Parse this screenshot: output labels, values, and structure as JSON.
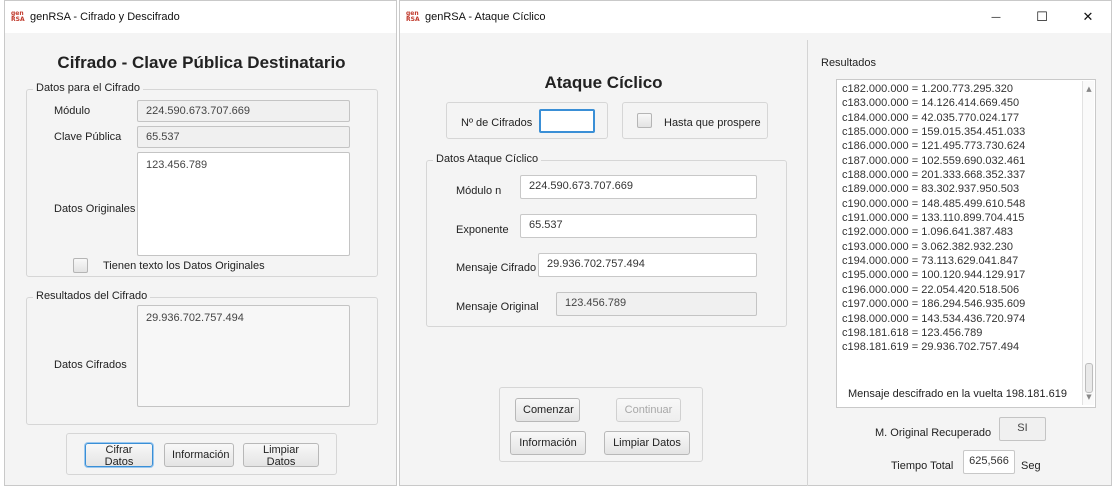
{
  "window1": {
    "logo_top": "gen",
    "logo_bottom": "RSA",
    "title": "genRSA - Cifrado y Descifrado",
    "heading": "Cifrado - Clave Pública Destinatario",
    "group_datos": {
      "legend": "Datos para el Cifrado",
      "modulo_label": "Módulo",
      "modulo_value": "224.590.673.707.669",
      "clave_label": "Clave Pública",
      "clave_value": "65.537",
      "originales_label": "Datos Originales",
      "originales_value": "123.456.789",
      "checkbox_label": "Tienen texto los Datos Originales"
    },
    "group_resultados": {
      "legend": "Resultados del Cifrado",
      "cifrados_label": "Datos Cifrados",
      "cifrados_value": "29.936.702.757.494"
    },
    "buttons": {
      "cifrar": "Cifrar Datos",
      "informacion": "Información",
      "limpiar": "Limpiar Datos"
    }
  },
  "window2": {
    "logo_top": "gen",
    "logo_bottom": "RSA",
    "title": "genRSA - Ataque Cíclico",
    "controls": {
      "minimize": "—",
      "maximize": "☐",
      "close": "✕"
    },
    "heading": "Ataque Cíclico",
    "num_cifrados_label": "Nº de Cifrados",
    "num_cifrados_value": "",
    "hasta_label": "Hasta que prospere",
    "group_ataque": {
      "legend": "Datos Ataque Cíclico",
      "modulo_label": "Módulo n",
      "modulo_value": "224.590.673.707.669",
      "exponente_label": "Exponente",
      "exponente_value": "65.537",
      "mensaje_cifrado_label": "Mensaje Cifrado",
      "mensaje_cifrado_value": "29.936.702.757.494",
      "mensaje_original_label": "Mensaje Original",
      "mensaje_original_value": "123.456.789"
    },
    "buttons": {
      "comenzar": "Comenzar",
      "continuar": "Continuar",
      "informacion": "Información",
      "limpiar": "Limpiar Datos"
    },
    "resultados": {
      "legend": "Resultados",
      "lines": [
        "c182.000.000 = 1.200.773.295.320",
        "c183.000.000 = 14.126.414.669.450",
        "c184.000.000 = 42.035.770.024.177",
        "c185.000.000 = 159.015.354.451.033",
        "c186.000.000 = 121.495.773.730.624",
        "c187.000.000 = 102.559.690.032.461",
        "c188.000.000 = 201.333.668.352.337",
        "c189.000.000 = 83.302.937.950.503",
        "c190.000.000 = 148.485.499.610.548",
        "c191.000.000 = 133.110.899.704.415",
        "c192.000.000 = 1.096.641.387.483",
        "c193.000.000 = 3.062.382.932.230",
        "c194.000.000 = 73.113.629.041.847",
        "c195.000.000 = 100.120.944.129.917",
        "c196.000.000 = 22.054.420.518.506",
        "c197.000.000 = 186.294.546.935.609",
        "c198.000.000 = 143.534.436.720.974",
        "c198.181.618 = 123.456.789",
        "c198.181.619 = 29.936.702.757.494"
      ],
      "footer": "Mensaje descifrado en la vuelta 198.181.619"
    },
    "recuperado_label": "M. Original Recuperado",
    "recuperado_value": "SI",
    "tiempo_label": "Tiempo Total",
    "tiempo_value": "625,566",
    "tiempo_unit": "Seg"
  }
}
